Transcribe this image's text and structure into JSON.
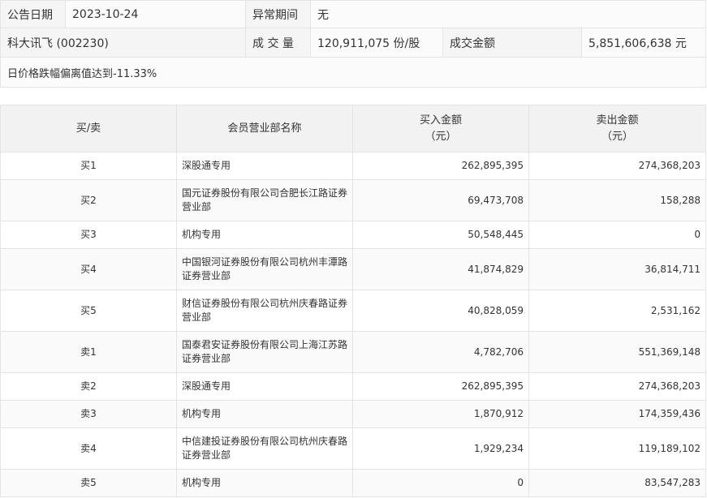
{
  "info": {
    "date_label": "公告日期",
    "date_value": "2023-10-24",
    "period_label": "异常期间",
    "period_value": "无",
    "stock_name": "科大讯飞 (002230)",
    "volume_label": "成 交 量",
    "volume_value": "120,911,075 份/股",
    "amount_label": "成交金额",
    "amount_value": "5,851,606,638 元",
    "reason": "日价格跌幅偏离值达到-11.33%"
  },
  "table": {
    "headers": {
      "side": "买/卖",
      "name": "会员营业部名称",
      "buy_l1": "买入金额",
      "buy_l2": "（元）",
      "sell_l1": "卖出金额",
      "sell_l2": "（元）"
    },
    "rows": [
      {
        "side": "买1",
        "name": "深股通专用",
        "buy": "262,895,395",
        "sell": "274,368,203"
      },
      {
        "side": "买2",
        "name": "国元证券股份有限公司合肥长江路证券营业部",
        "buy": "69,473,708",
        "sell": "158,288"
      },
      {
        "side": "买3",
        "name": "机构专用",
        "buy": "50,548,445",
        "sell": "0"
      },
      {
        "side": "买4",
        "name": "中国银河证券股份有限公司杭州丰潭路证券营业部",
        "buy": "41,874,829",
        "sell": "36,814,711"
      },
      {
        "side": "买5",
        "name": "财信证券股份有限公司杭州庆春路证券营业部",
        "buy": "40,828,059",
        "sell": "2,531,162"
      },
      {
        "side": "卖1",
        "name": "国泰君安证券股份有限公司上海江苏路证券营业部",
        "buy": "4,782,706",
        "sell": "551,369,148"
      },
      {
        "side": "卖2",
        "name": "深股通专用",
        "buy": "262,895,395",
        "sell": "274,368,203"
      },
      {
        "side": "卖3",
        "name": "机构专用",
        "buy": "1,870,912",
        "sell": "174,359,436"
      },
      {
        "side": "卖4",
        "name": "中信建投证券股份有限公司杭州庆春路证券营业部",
        "buy": "1,929,234",
        "sell": "119,189,102"
      },
      {
        "side": "卖5",
        "name": "机构专用",
        "buy": "0",
        "sell": "83,547,283"
      }
    ]
  }
}
